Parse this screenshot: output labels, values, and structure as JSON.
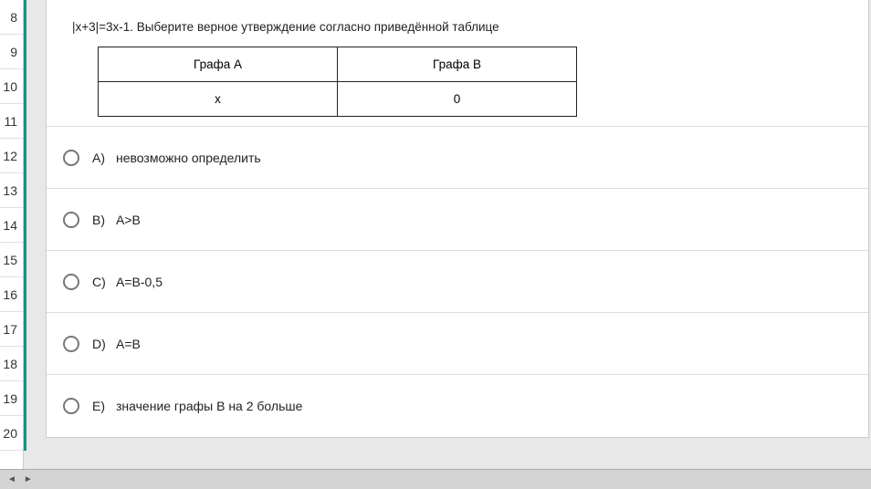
{
  "sidebar": {
    "items": [
      "8",
      "9",
      "10",
      "11",
      "12",
      "13",
      "14",
      "15",
      "16",
      "17",
      "18",
      "19",
      "20"
    ]
  },
  "question": {
    "text": "|x+3|=3x-1. Выберите верное утверждение согласно приведённой таблице",
    "table": {
      "headerA": "Графа A",
      "headerB": "Графа B",
      "valA": "x",
      "valB": "0"
    }
  },
  "options": [
    {
      "letter": "A)",
      "text": "невозможно определить"
    },
    {
      "letter": "B)",
      "text": "A>B"
    },
    {
      "letter": "C)",
      "text": "A=B-0,5"
    },
    {
      "letter": "D)",
      "text": "A=B"
    },
    {
      "letter": "E)",
      "text": "значение графы B на 2 больше"
    }
  ],
  "bottombar": {
    "left": "◄",
    "right": "►"
  }
}
